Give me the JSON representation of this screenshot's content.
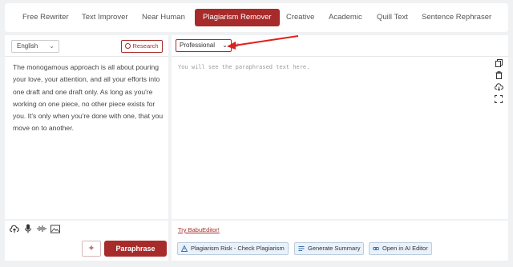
{
  "modes": {
    "items": [
      {
        "label": "Free Rewriter",
        "active": false
      },
      {
        "label": "Text Improver",
        "active": false
      },
      {
        "label": "Near Human",
        "active": false
      },
      {
        "label": "Plagiarism Remover",
        "active": true
      },
      {
        "label": "Creative",
        "active": false
      },
      {
        "label": "Academic",
        "active": false
      },
      {
        "label": "Quill Text",
        "active": false
      },
      {
        "label": "Sentence Rephraser",
        "active": false
      }
    ]
  },
  "input_panel": {
    "language": "English",
    "research_label": "Research",
    "text": "The monogamous approach is all about pouring your love, your attention, and all your efforts into one draft and one draft only. As long as you're working on one piece, no other piece exists for you. It's only when you're done with one, that you move on to another."
  },
  "output_panel": {
    "style": "Professional",
    "placeholder": "You will see the paraphrased text here."
  },
  "bottom": {
    "paraphrase_label": "Paraphrase",
    "try_link": "Try BabuEditor!",
    "chips": [
      {
        "label": "Plagiarism Risk - Check Plagiarism",
        "icon": "alert-icon"
      },
      {
        "label": "Generate Summary",
        "icon": "summary-icon"
      },
      {
        "label": "Open in AI Editor",
        "icon": "link-icon"
      }
    ]
  },
  "colors": {
    "accent": "#a72b2b",
    "annotation_arrow": "#e0201c",
    "chip_bg": "#e9f1fb"
  }
}
